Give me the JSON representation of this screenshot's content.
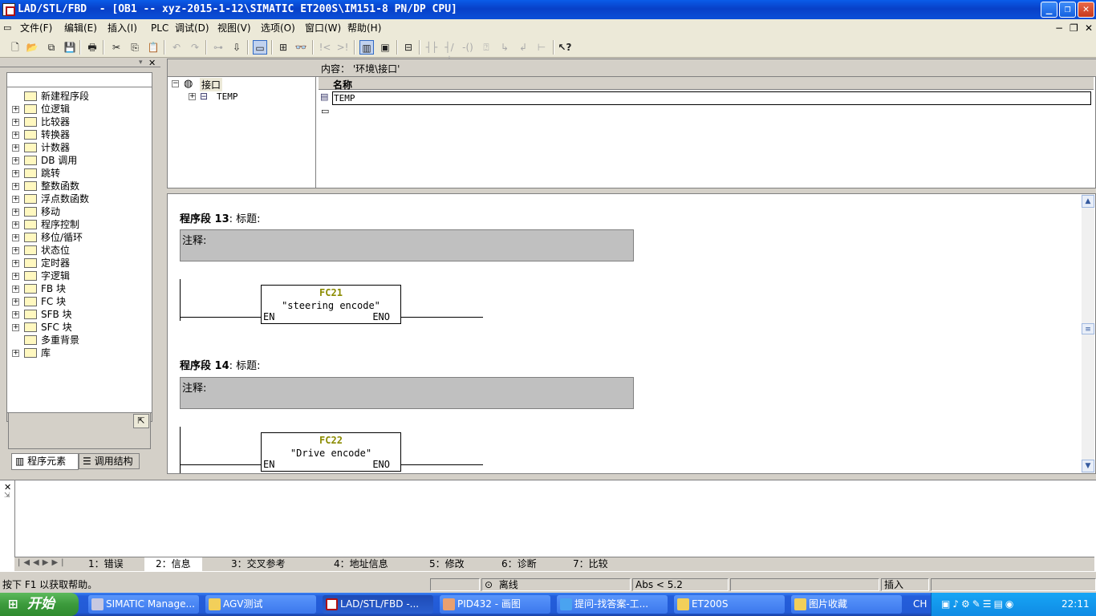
{
  "window": {
    "title": "LAD/STL/FBD  - [OB1 -- xyz-2015-1-12\\SIMATIC ET200S\\IM151-8 PN/DP CPU]",
    "buttons": {
      "minimize": "_",
      "restore": "❐",
      "close": "✕"
    }
  },
  "menu": [
    "文件(F)",
    "编辑(E)",
    "插入(I)",
    "PLC",
    "调试(D)",
    "视图(V)",
    "选项(O)",
    "窗口(W)",
    "帮助(H)"
  ],
  "mdi_controls": [
    "−",
    "❐",
    "✕"
  ],
  "tree": {
    "items": [
      {
        "label": "新建程序段",
        "icon": "network-icon",
        "expand": false
      },
      {
        "label": "位逻辑",
        "icon": "bit-logic-icon",
        "expand": true
      },
      {
        "label": "比较器",
        "icon": "comparator-icon",
        "expand": true
      },
      {
        "label": "转换器",
        "icon": "converter-icon",
        "expand": true
      },
      {
        "label": "计数器",
        "icon": "counter-icon",
        "expand": true
      },
      {
        "label": "DB 调用",
        "icon": "db-call-icon",
        "expand": true
      },
      {
        "label": "跳转",
        "icon": "jump-icon",
        "expand": true
      },
      {
        "label": "整数函数",
        "icon": "integer-function-icon",
        "expand": true
      },
      {
        "label": "浮点数函数",
        "icon": "float-function-icon",
        "expand": true
      },
      {
        "label": "移动",
        "icon": "move-icon",
        "expand": true
      },
      {
        "label": "程序控制",
        "icon": "program-control-icon",
        "expand": true
      },
      {
        "label": "移位/循环",
        "icon": "shift-rotate-icon",
        "expand": true
      },
      {
        "label": "状态位",
        "icon": "status-bit-icon",
        "expand": true
      },
      {
        "label": "定时器",
        "icon": "timer-icon",
        "expand": true
      },
      {
        "label": "字逻辑",
        "icon": "word-logic-icon",
        "expand": true
      },
      {
        "label": "FB 块",
        "icon": "fb-block-icon",
        "expand": true
      },
      {
        "label": "FC 块",
        "icon": "fc-block-icon",
        "expand": true
      },
      {
        "label": "SFB 块",
        "icon": "sfb-block-icon",
        "expand": true
      },
      {
        "label": "SFC 块",
        "icon": "sfc-block-icon",
        "expand": true
      },
      {
        "label": "多重背景",
        "icon": "multi-instance-icon",
        "expand": false
      },
      {
        "label": "库",
        "icon": "library-icon",
        "expand": true
      }
    ],
    "tabs": {
      "elements": "程序元素",
      "call_structure": "调用结构"
    }
  },
  "interface": {
    "root": "接口",
    "child": "TEMP",
    "content_label": "内容： '环境\\接口'",
    "column_name": "名称",
    "row_value": "TEMP"
  },
  "networks": [
    {
      "label": "程序段",
      "number": "13",
      "title_suffix": ": 标题:",
      "comment": "注释:",
      "block": "FC21",
      "symbol": "\"steering encode\"",
      "en": "EN",
      "eno": "ENO"
    },
    {
      "label": "程序段",
      "number": "14",
      "title_suffix": ": 标题:",
      "comment": "注释:",
      "block": "FC22",
      "symbol": "\"Drive encode\"",
      "en": "EN",
      "eno": "ENO"
    }
  ],
  "output_tabs": [
    "1：错误",
    "2：信息",
    "3：交叉参考",
    "4：地址信息",
    "5：修改",
    "6：诊断",
    "7：比较"
  ],
  "status": {
    "help": "按下 F1 以获取帮助。",
    "mode": "离线",
    "position": "Abs < 5.2",
    "insert": "插入"
  },
  "taskbar": {
    "start": "开始",
    "tasks": [
      "SIMATIC Manage...",
      "AGV测试",
      "LAD/STL/FBD  -...",
      "PID432 - 画图",
      "提问-找答案-工...",
      "ET200S",
      "图片收藏"
    ],
    "lang": "CH",
    "clock": "22:11"
  }
}
